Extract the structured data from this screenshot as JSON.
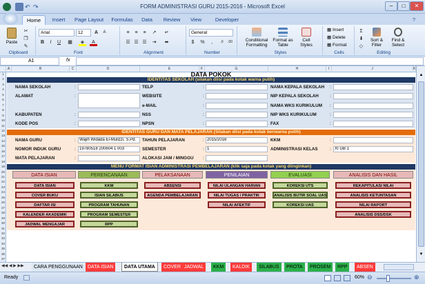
{
  "window": {
    "title": "FORM ADMINISTRASI GURU 2015-2016  -  Microsoft Excel"
  },
  "tabs": [
    "Home",
    "Insert",
    "Page Layout",
    "Formulas",
    "Data",
    "Review",
    "View",
    "Developer"
  ],
  "ribbon": {
    "clipboard": {
      "label": "Clipboard",
      "paste": "Paste"
    },
    "font": {
      "label": "Font",
      "name": "Arial",
      "size": "12"
    },
    "alignment": {
      "label": "Alignment"
    },
    "number": {
      "label": "Number",
      "format": "General"
    },
    "styles": {
      "label": "Styles",
      "conditional": "Conditional Formatting",
      "format_table": "Format as Table",
      "cell_styles": "Cell Styles"
    },
    "cells": {
      "label": "Cells",
      "insert": "Insert",
      "delete": "Delete",
      "format": "Format"
    },
    "editing": {
      "label": "Editing",
      "sort": "Sort & Filter",
      "find": "Find & Select"
    }
  },
  "formula_bar": {
    "cell": "A1",
    "fx": "fx"
  },
  "columns": [
    "A",
    "B",
    "C",
    "D",
    "E",
    "F",
    "G",
    "H",
    "I",
    "J",
    "K",
    "L",
    "M"
  ],
  "rows": [
    "1",
    "2",
    "3",
    "4",
    "5",
    "6",
    "7",
    "8",
    "9",
    "10",
    "11",
    "12",
    "13",
    "14",
    "15",
    "16",
    "17",
    "18",
    "19",
    "20",
    "21",
    "22",
    "23",
    "24",
    "25",
    "26",
    "27",
    "28",
    "29",
    "30",
    "31",
    "32",
    "33",
    "34",
    "35",
    "36",
    "37"
  ],
  "sheet": {
    "title": "DATA POKOK",
    "sec_school": "IDENTITAS SEKOLAH (silakan diisi pada kotak warna putih)",
    "school_left": [
      "NAMA SEKOLAH",
      "ALAMAT",
      "KABUPATEN",
      "KODE POS"
    ],
    "school_mid": [
      "TELP",
      "WEBSITE",
      "e-MAIL",
      "NSS",
      "NPSN"
    ],
    "school_right": [
      "NAMA KEPALA SEKOLAH",
      "NIP KEPALA SEKOLAH",
      "NAMA WKS KURIKULUM",
      "NIP WKS KURIKULUM",
      "FAX"
    ],
    "sec_teacher": "IDENTITAS GURU DAN MATA PELAJARAN (Silakan diisi pada kotak berwarna putih)",
    "teacher_left": [
      "NAMA GURU",
      "NOMOR INDUK GURU",
      "MATA PELAJARAN"
    ],
    "teacher_mid": [
      "TAHUN PELAJARAN",
      "SEMESTER",
      "ALOKASI JAM / MINGGU"
    ],
    "teacher_right": [
      "KKM",
      "ADMINISTRASI KELAS"
    ],
    "teacher_name": "Wajih Widada El-Mulizzi, S.Pd.",
    "teacher_nig": "19780518 200604 1 003",
    "year": "2015/2016",
    "semester": "1",
    "kelas": "XI GB 1",
    "sec_menu": "MENU FORMAT ISIAN ADMINISTRASI PEMBELAJARAN (klik saja pada kotak yang diinginkan)",
    "menu_heads": [
      "DATA ISIAN",
      "PERENCANAAN",
      "PELAKSANAAN",
      "PENILAIAN",
      "EVALUASI",
      "ANALISIS DAN HASIL"
    ],
    "menu_col1": [
      "DATA ISIAN",
      "COVER BUKU",
      "DAFTAR ISI",
      "KALENDER AKADEMIK",
      "JADWAL MENGAJAR"
    ],
    "menu_col2": [
      "KKM",
      "ISIAN SILABUS",
      "PROGRAM TAHUNAN",
      "PROGRAM SEMESTER",
      "RPP"
    ],
    "menu_col3": [
      "ABSENSI",
      "AGENDA PEMBELAJARAN"
    ],
    "menu_col4": [
      "NILAI ULANGAN HARIAN",
      "NILAI TUGAS / PRAKTIK",
      "NILAI AFEKTIF"
    ],
    "menu_col5": [
      "KOREKSI UTS",
      "ANALISIS BUTIR SOAL UAS",
      "KOREKSI UAS"
    ],
    "menu_col6": [
      "REKAPITULASI NILAI",
      "ANALISIS KETUNTASAN",
      "NILAI RAPORT",
      "ANALISIS DSS/DSK"
    ]
  },
  "sheet_tabs": [
    "CARA PENGGUNAAN",
    "DATA ISIAN",
    "DATA UTAMA",
    "COVER",
    "JADWAL",
    "KKM",
    "KALDIK",
    "SILABUS",
    "PROTA",
    "PROSEM",
    "RPP",
    "ABSEN"
  ],
  "status": {
    "ready": "Ready",
    "zoom": "60%"
  },
  "colors": {
    "school_bar": "#1f3864",
    "teacher_bar": "#e36c0a",
    "menu_bar": "#1f3864",
    "form_bg": "#dbe5f1",
    "menu_bg": "#fde9d9"
  }
}
